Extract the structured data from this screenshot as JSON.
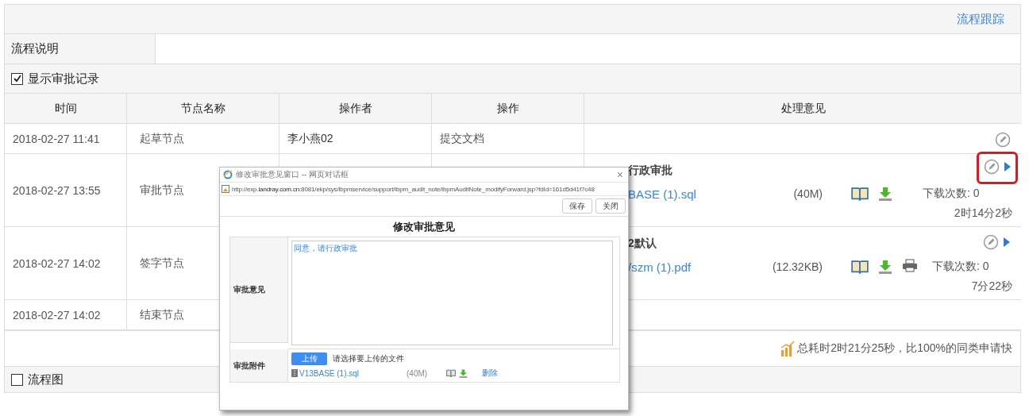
{
  "header": {
    "link": "流程跟踪"
  },
  "description": {
    "label": "流程说明"
  },
  "show_records": {
    "label": "显示审批记录",
    "checked": true
  },
  "table": {
    "columns": [
      "时间",
      "节点名称",
      "操作者",
      "操作",
      "处理意见"
    ],
    "rows": [
      {
        "time": "2018-02-27 11:41",
        "node": "起草节点",
        "operator": "李小燕02",
        "operation": "提交文档",
        "opinion": {
          "editable": true,
          "expandable": false,
          "highlighted": false
        }
      },
      {
        "time": "2018-02-27 13:55",
        "node": "审批节点",
        "opinion": {
          "text": "行政审批",
          "attachment": {
            "name": "BASE (1).sql",
            "size": "(40M)",
            "printable": false,
            "downloads": "下载次数: 0"
          },
          "duration": "2时14分2秒",
          "editable": true,
          "expandable": true,
          "highlighted": true
        }
      },
      {
        "time": "2018-02-27 14:02",
        "node": "签字节点",
        "opinion": {
          "text": "2默认",
          "attachment": {
            "name": "/szm (1).pdf",
            "size": "(12.32KB)",
            "printable": true,
            "downloads": "下载次数: 0"
          },
          "duration": "7分22秒",
          "editable": true,
          "expandable": true,
          "highlighted": false
        }
      },
      {
        "time": "2018-02-27 14:02",
        "node": "结束节点",
        "opinion": {
          "editable": false,
          "expandable": false,
          "highlighted": false
        }
      }
    ]
  },
  "summary": "总耗时2时21分25秒，比100%的同类申请快",
  "flowchart": {
    "label": "流程图",
    "checked": false
  },
  "dialog": {
    "title": "修改审批意见窗口 -- 网页对话框",
    "close": "×",
    "url": "http://exp.**landray.com.cn**:8081/ekp/sys/lbpmservice/support/lbpm_audit_note/lbpmAuditNote_modifyForward.jsp?fdId=161d5d41f7c48",
    "buttons": [
      "保存",
      "关闭"
    ],
    "heading": "修改审批意见",
    "opinion_label": "审批意见",
    "opinion_value": "同意，请行政审批",
    "attachment_label": "审批附件",
    "upload_button": "上传",
    "upload_hint": "请选择要上传的文件",
    "file": {
      "name": "V13BASE (1).sql",
      "size": "(40M)",
      "delete": "删除"
    }
  }
}
